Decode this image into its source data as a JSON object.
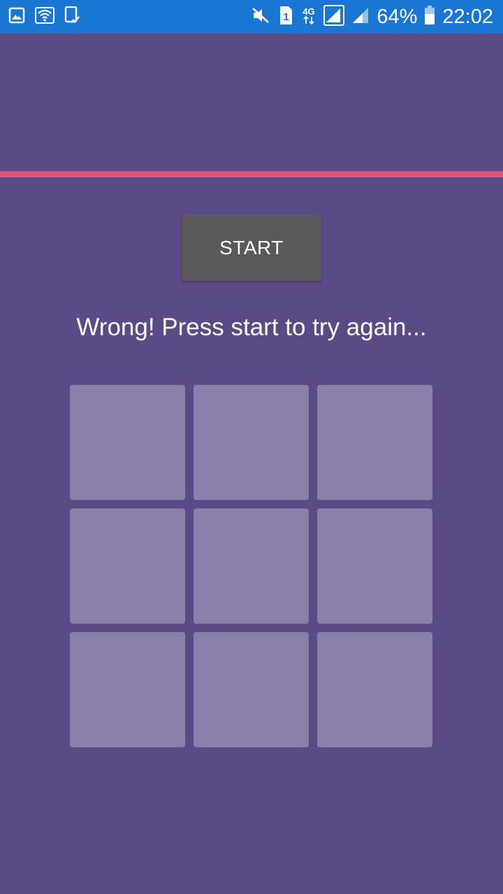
{
  "status_bar": {
    "battery_percent": "64%",
    "time": "22:02",
    "network_type": "4G",
    "sim_slot": "1",
    "left_icons": [
      "gallery-icon",
      "wifi-icon",
      "device-check-icon"
    ],
    "right_icons": [
      "mute-icon",
      "sim-icon",
      "network-4g-icon",
      "signal-icon",
      "signal-icon-2",
      "battery-icon"
    ]
  },
  "game": {
    "start_label": "START",
    "message": "Wrong! Press start to try again...",
    "tiles": [
      "",
      "",
      "",
      "",
      "",
      "",
      "",
      "",
      ""
    ]
  },
  "colors": {
    "status_bar": "#1976d2",
    "background": "#5c4a87",
    "accent_line": "#e1537a",
    "button": "#595959",
    "tile": "#8a7fa8"
  }
}
